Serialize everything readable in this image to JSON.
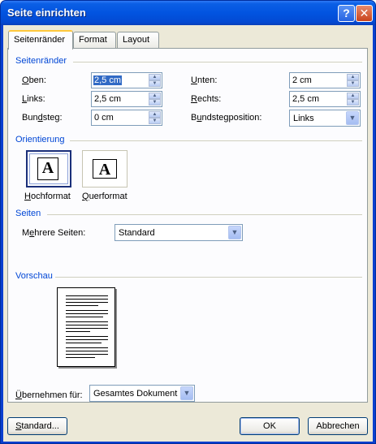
{
  "window": {
    "title": "Seite einrichten",
    "help_glyph": "?",
    "close_glyph": "✕"
  },
  "tabs": [
    {
      "label": "Seitenränder",
      "active": true
    },
    {
      "label": "Format",
      "active": false
    },
    {
      "label": "Layout",
      "active": false
    }
  ],
  "margins": {
    "group_label": "Seitenränder",
    "top": {
      "label_accel": "O",
      "label_rest": "ben:",
      "value": "2,5 cm"
    },
    "left": {
      "label_accel": "L",
      "label_rest": "inks:",
      "value": "2,5 cm"
    },
    "gutter": {
      "label_pre": "Bun",
      "label_accel": "d",
      "label_rest": "steg:",
      "value": "0 cm"
    },
    "bottom": {
      "label_accel": "U",
      "label_rest": "nten:",
      "value": "2 cm"
    },
    "right": {
      "label_accel": "R",
      "label_rest": "echts:",
      "value": "2,5 cm"
    },
    "gutter_position": {
      "label_pre": "B",
      "label_accel": "u",
      "label_rest": "ndstegposition:",
      "value": "Links"
    }
  },
  "orientation": {
    "group_label": "Orientierung",
    "icon_letter": "A",
    "portrait": {
      "label_accel": "H",
      "label_rest": "ochformat",
      "selected": true
    },
    "landscape": {
      "label_accel": "Q",
      "label_rest": "uerformat",
      "selected": false
    }
  },
  "pages": {
    "group_label": "Seiten",
    "multiple_label_pre": "M",
    "multiple_label_accel": "e",
    "multiple_label_rest": "hrere Seiten:",
    "multiple_value": "Standard"
  },
  "preview": {
    "group_label": "Vorschau"
  },
  "apply_to": {
    "label_accel": "Ü",
    "label_rest": "bernehmen für:",
    "value": "Gesamtes Dokument"
  },
  "buttons": {
    "default_accel": "S",
    "default_rest": "tandard...",
    "ok": "OK",
    "cancel": "Abbrechen"
  },
  "colors": {
    "title_bar": "#0254e0",
    "group_label": "#0046d5",
    "dialog_bg": "#ece9d8",
    "panel_bg": "#fcfcfe"
  },
  "icons": {
    "spin": "up-down-arrow-icon",
    "dropdown": "chevron-down-icon"
  }
}
